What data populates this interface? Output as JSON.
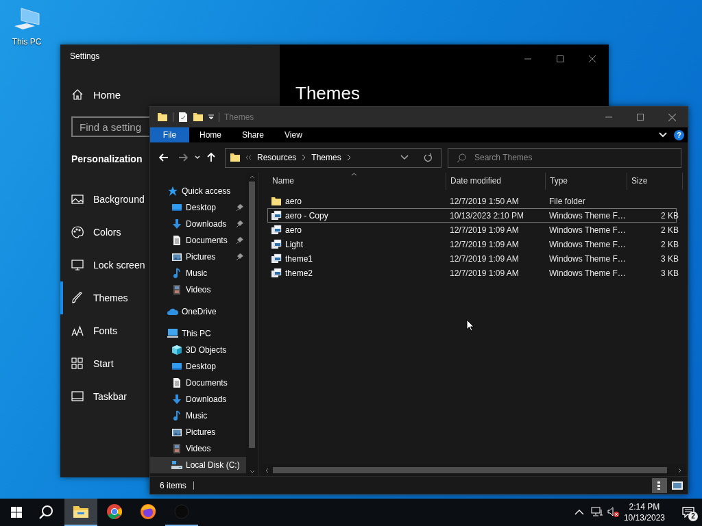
{
  "desktop": {
    "icons": [
      {
        "label": "This PC",
        "kind": "pc"
      }
    ]
  },
  "settings": {
    "title": "Settings",
    "home": "Home",
    "search": {
      "placeholder": "Find a setting"
    },
    "section": "Personalization",
    "heading": "Themes",
    "items": [
      {
        "label": "Background",
        "kind": "background",
        "selected": false
      },
      {
        "label": "Colors",
        "kind": "colors",
        "selected": false
      },
      {
        "label": "Lock screen",
        "kind": "lock",
        "selected": false
      },
      {
        "label": "Themes",
        "kind": "themes",
        "selected": true
      },
      {
        "label": "Fonts",
        "kind": "fonts",
        "selected": false
      },
      {
        "label": "Start",
        "kind": "start",
        "selected": false
      },
      {
        "label": "Taskbar",
        "kind": "taskbar",
        "selected": false
      }
    ]
  },
  "explorer": {
    "title": "Themes",
    "ribbon_tabs": [
      {
        "label": "File",
        "selected": true
      },
      {
        "label": "Home",
        "selected": false
      },
      {
        "label": "Share",
        "selected": false
      },
      {
        "label": "View",
        "selected": false
      }
    ],
    "help": "?",
    "forward_disabled": true,
    "breadcrumb": [
      "Resources",
      "Themes"
    ],
    "search": {
      "placeholder": "Search Themes"
    },
    "nav": [
      {
        "label": "Quick access",
        "kind": "star",
        "selected": false,
        "children": [
          {
            "label": "Desktop",
            "kind": "desktop",
            "pinned": true,
            "selected": false
          },
          {
            "label": "Downloads",
            "kind": "download",
            "pinned": true,
            "selected": false
          },
          {
            "label": "Documents",
            "kind": "document",
            "pinned": true,
            "selected": false
          },
          {
            "label": "Pictures",
            "kind": "picture",
            "pinned": true,
            "selected": false
          },
          {
            "label": "Music",
            "kind": "music",
            "pinned": false,
            "selected": false
          },
          {
            "label": "Videos",
            "kind": "video",
            "pinned": false,
            "selected": false
          }
        ]
      },
      {
        "label": "OneDrive",
        "kind": "cloud",
        "selected": false
      },
      {
        "label": "This PC",
        "kind": "pc",
        "selected": false,
        "children": [
          {
            "label": "3D Objects",
            "kind": "cube",
            "selected": false
          },
          {
            "label": "Desktop",
            "kind": "desktop",
            "selected": false
          },
          {
            "label": "Documents",
            "kind": "document",
            "selected": false
          },
          {
            "label": "Downloads",
            "kind": "download",
            "selected": false
          },
          {
            "label": "Music",
            "kind": "music",
            "selected": false
          },
          {
            "label": "Pictures",
            "kind": "picture",
            "selected": false
          },
          {
            "label": "Videos",
            "kind": "video",
            "selected": false
          },
          {
            "label": "Local Disk (C:)",
            "kind": "disk",
            "selected": true
          }
        ]
      }
    ],
    "columns": [
      "Name",
      "Date modified",
      "Type",
      "Size"
    ],
    "rows": [
      {
        "name": "aero",
        "kind": "folder",
        "date": "12/7/2019 1:50 AM",
        "type": "File folder",
        "selected": false
      },
      {
        "name": "aero - Copy",
        "kind": "theme",
        "date": "10/13/2023 2:10 PM",
        "type": "Windows Theme F…",
        "size": "2 KB",
        "selected": true
      },
      {
        "name": "aero",
        "kind": "theme",
        "date": "12/7/2019 1:09 AM",
        "type": "Windows Theme F…",
        "size": "2 KB",
        "selected": false
      },
      {
        "name": "Light",
        "kind": "theme",
        "date": "12/7/2019 1:09 AM",
        "type": "Windows Theme F…",
        "size": "2 KB",
        "selected": false
      },
      {
        "name": "theme1",
        "kind": "theme",
        "date": "12/7/2019 1:09 AM",
        "type": "Windows Theme F…",
        "size": "3 KB",
        "selected": false
      },
      {
        "name": "theme2",
        "kind": "theme",
        "date": "12/7/2019 1:09 AM",
        "type": "Windows Theme F…",
        "size": "3 KB",
        "selected": false
      }
    ],
    "status": "6 items"
  },
  "taskbar": {
    "apps": [
      {
        "kind": "explorer",
        "active": true,
        "running": true
      },
      {
        "kind": "chrome",
        "active": false,
        "running": false
      },
      {
        "kind": "firefox",
        "active": false,
        "running": false
      },
      {
        "kind": "dark",
        "active": false,
        "running": true
      }
    ],
    "time": "2:14 PM",
    "date": "10/13/2023",
    "notifications": "2"
  }
}
